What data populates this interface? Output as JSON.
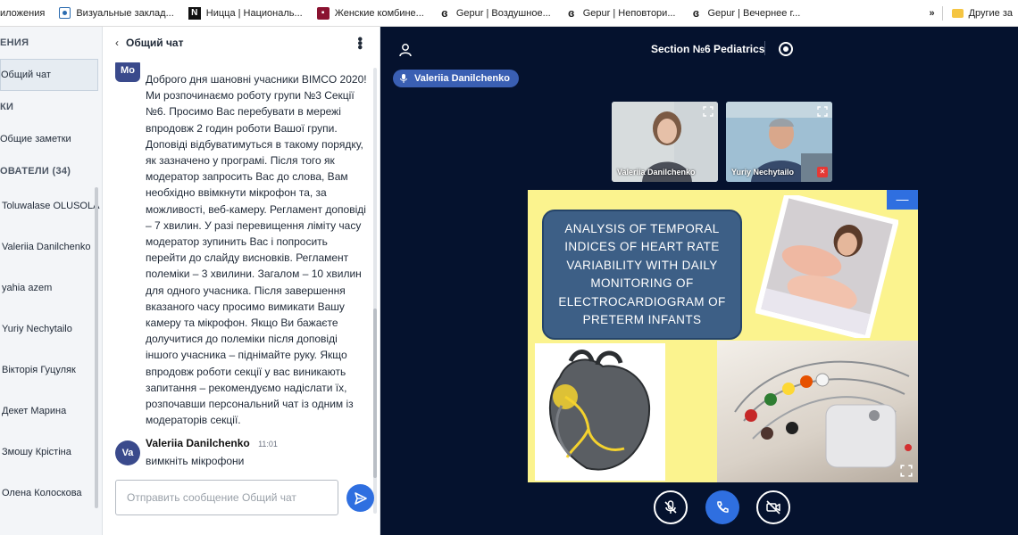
{
  "bookmarks": {
    "items": [
      {
        "label": "иложения",
        "icon": "apps-icon"
      },
      {
        "label": "Визуальные заклад...",
        "icon": "visual-bookmarks-icon"
      },
      {
        "label": "Ницца | Националь...",
        "icon": "n-logo-icon"
      },
      {
        "label": "Женские комбине...",
        "icon": "store-icon"
      },
      {
        "label": "Gepur | Воздушное...",
        "icon": "gepur-icon"
      },
      {
        "label": "Gepur | Неповтори...",
        "icon": "gepur-icon"
      },
      {
        "label": "Gepur | Вечернее г...",
        "icon": "gepur-icon"
      }
    ],
    "overflow": "»",
    "other": "Другие за"
  },
  "sidebar": {
    "messages_header": "ЕНИЯ",
    "public_chat": "Общий чат",
    "notes_header": "КИ",
    "shared_notes": "Общие заметки",
    "users_header": "ОВАТЕЛИ (34)",
    "users": [
      "Toluwalase OLUSOLA",
      "Valeriia Danilchenko",
      "yahia azem",
      "Yuriy Nechytailo",
      "Вікторія Гуцуляк",
      "Декет Марина",
      "Змошу Крістіна",
      "Олена Колоскова"
    ]
  },
  "chat": {
    "title": "Общий чат",
    "messages": [
      {
        "avatar": "Mo",
        "text": "Доброго дня шановні учасники BIMCO 2020! Ми розпочинаємо роботу групи №3 Секції №6. Просимо Вас перебувати в мережі впродовж 2 годин роботи Вашої групи. Доповіді відбуватимуться в такому порядку, як зазначено у програмі. Після того як модератор запросить Вас до слова, Вам необхідно ввімкнути мікрофон та, за можливості, веб-камеру. Регламент доповіді – 7 хвилин. У разі перевищення ліміту часу модератор зупинить Вас і попросить перейти до слайду висновків. Регламент полеміки – 3 хвилини. Загалом – 10 хвилин для одного учасника. Після завершення вказаного часу просимо вимикати Вашу камеру та мікрофон. Якщо Ви бажаєте долучитися до полеміки після доповіді іншого учасника – піднімайте руку. Якщо впродовж роботи секції у вас виникають запитання – рекомендуємо надіслати їх, розпочавши персональний чат із одним із модераторів секції."
      },
      {
        "avatar": "Va",
        "sender": "Valeriia Danilchenko",
        "time": "11:01",
        "text": "вимкніть мікрофони"
      }
    ],
    "input_placeholder": "Отправить сообщение Общий чат"
  },
  "stage": {
    "session_title": "Section №6 Pediatrics",
    "active_speaker": "Valeriia Danilchenko",
    "tiles": [
      {
        "name": "Valeriia Danilchenko"
      },
      {
        "name": "Yuriy Nechytailo"
      }
    ],
    "slide_title": "ANALYSIS OF TEMPORAL INDICES OF HEART RATE VARIABILITY WITH DAILY MONITORING OF ELECTROCARDIOGRAM OF PRETERM INFANTS",
    "minimize_label": "—"
  },
  "colors": {
    "stage_bg": "#05122e",
    "accent_blue": "#2f6fe0",
    "slide_bg": "#fbf38e",
    "slide_title_bg": "#3d5f86"
  }
}
